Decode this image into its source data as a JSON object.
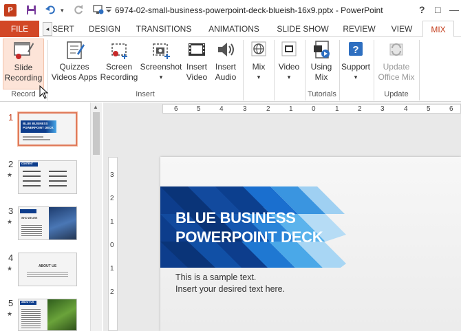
{
  "titlebar": {
    "app_icon": "P",
    "title": "6974-02-small-business-powerpoint-deck-blueish-16x9.pptx - PowerPoint",
    "help": "?",
    "ribbon_display": "□",
    "minimize": "—"
  },
  "tabs": {
    "file": "FILE",
    "scroll": "◂",
    "items": [
      "SERT",
      "DESIGN",
      "TRANSITIONS",
      "ANIMATIONS",
      "SLIDE SHOW",
      "REVIEW",
      "VIEW",
      "MIX"
    ]
  },
  "ribbon": {
    "groups": {
      "record": "Record",
      "insert": "Insert",
      "tutorials": "Tutorials",
      "update": "Update"
    },
    "buttons": {
      "slide_recording_1": "Slide",
      "slide_recording_2": "Recording",
      "quizzes_1": "Quizzes",
      "quizzes_2": "Videos Apps",
      "screen_rec_1": "Screen",
      "screen_rec_2": "Recording",
      "screenshot_1": "Screenshot",
      "screenshot_2": "▾",
      "insert_video_1": "Insert",
      "insert_video_2": "Video",
      "insert_audio_1": "Insert",
      "insert_audio_2": "Audio",
      "mix_1": "Mix",
      "mix_2": "▾",
      "video_1": "Video",
      "video_2": "▾",
      "using_mix_1": "Using",
      "using_mix_2": "Mix",
      "support_1": "Support",
      "support_2": "▾",
      "update_1": "Update",
      "update_2": "Office Mix"
    }
  },
  "thumbnails": [
    {
      "num": "1",
      "star": "",
      "title": "BLUE BUSINESS POWERPOINT DECK"
    },
    {
      "num": "2",
      "star": "★",
      "title": "CONTENT"
    },
    {
      "num": "3",
      "star": "★",
      "title": "WHO WE ARE"
    },
    {
      "num": "4",
      "star": "★",
      "title": "ABOUT US"
    },
    {
      "num": "5",
      "star": "★",
      "title": "ABOUT US"
    }
  ],
  "hruler": [
    "6",
    "5",
    "4",
    "3",
    "2",
    "1",
    "0",
    "1",
    "2",
    "3",
    "4",
    "5",
    "6"
  ],
  "vruler": [
    "3",
    "2",
    "1",
    "0",
    "1",
    "2"
  ],
  "slide": {
    "title_1": "BLUE BUSINESS",
    "title_2": "POWERPOINT DECK",
    "body_1": "This is a sample text.",
    "body_2": "Insert your desired text here."
  },
  "colors": {
    "accent": "#d24726",
    "banner_dark": "#0d3d8c",
    "banner_light": "#4aa8e8"
  }
}
